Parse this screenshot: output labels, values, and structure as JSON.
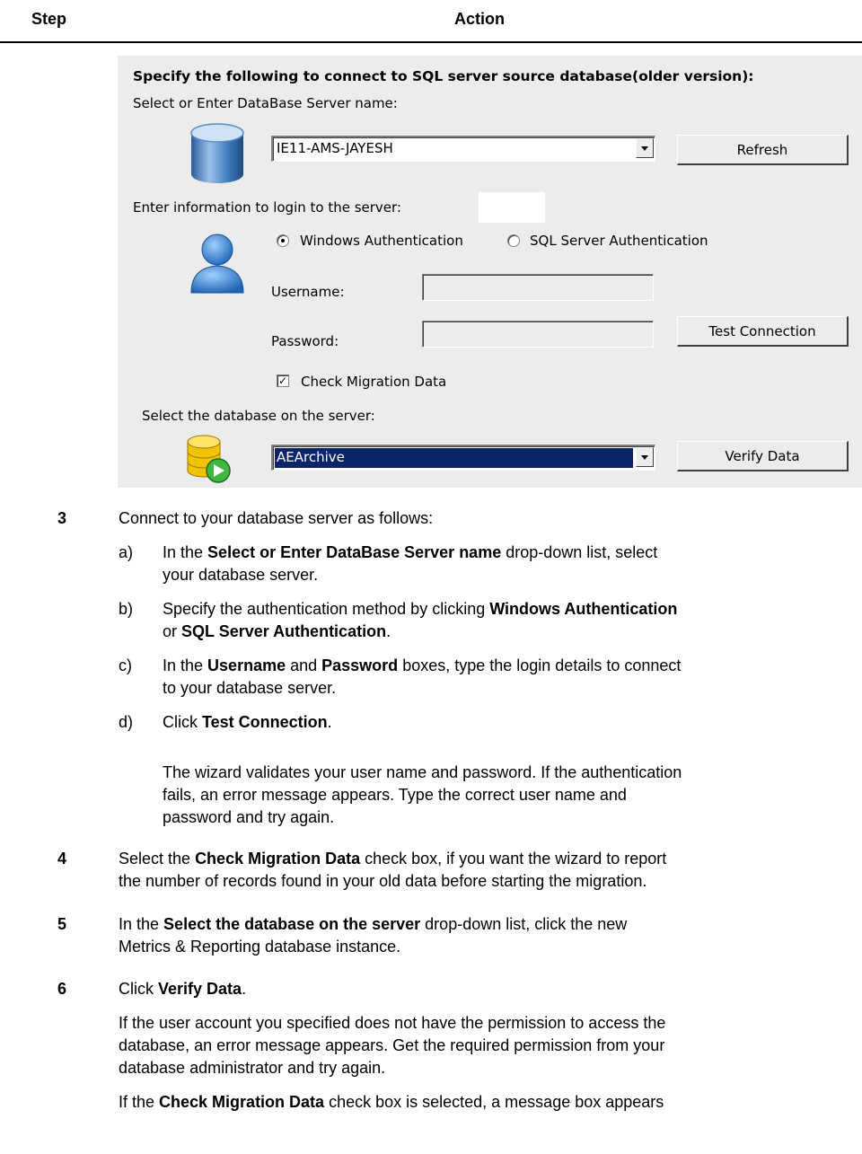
{
  "header": {
    "step": "Step",
    "action": "Action"
  },
  "dialog": {
    "title": "Specify the following to connect to SQL server source database(older version):",
    "server_label": "Select or Enter DataBase Server name:",
    "server_value": "IE11-AMS-JAYESH",
    "refresh": "Refresh",
    "login_label": "Enter information to login to the server:",
    "windows_auth": "Windows Authentication",
    "sql_auth": "SQL Server Authentication",
    "username_label": "Username:",
    "password_label": "Password:",
    "test_connection": "Test Connection",
    "check_migration": "Check Migration Data",
    "database_label": "Select the database on the server:",
    "database_value": "AEArchive",
    "verify_data": "Verify Data"
  },
  "steps": {
    "s3": {
      "num": "3",
      "intro": "Connect to your database server as follows:",
      "a_label": "a)",
      "a_pre": "In the ",
      "a_bold": "Select or Enter DataBase Server name",
      "a_post": " drop-down list, select",
      "a_line2": "your database server.",
      "b_label": "b)",
      "b_pre": "Specify the authentication method by clicking ",
      "b_bold1": "Windows Authentication",
      "b_or": "or ",
      "b_bold2": "SQL Server Authentication",
      "b_post": ".",
      "c_label": "c)",
      "c_pre": "In the ",
      "c_bold1": "Username",
      "c_and": " and ",
      "c_bold2": "Password",
      "c_post": " boxes, type the login details to connect",
      "c_line2": "to your database server.",
      "d_label": "d)",
      "d_pre": "Click ",
      "d_bold": "Test Connection",
      "d_post": ".",
      "note_l1": "The wizard validates your user name and password. If the authentication",
      "note_l2": "fails, an error message appears. Type the correct user name and",
      "note_l3": "password and try again."
    },
    "s4": {
      "num": "4",
      "pre": "Select the ",
      "bold": "Check Migration Data",
      "post": " check box, if you want the wizard to report",
      "line2": "the number of records found in your old data before starting the migration."
    },
    "s5": {
      "num": "5",
      "pre": "In the ",
      "bold": "Select the database on the server",
      "post": " drop-down list, click the new",
      "line2": "Metrics & Reporting database instance."
    },
    "s6": {
      "num": "6",
      "pre": "Click ",
      "bold": "Verify Data",
      "post": ".",
      "p1_l1": "If the user account you specified does not have the permission to access the",
      "p1_l2": "database, an error message appears. Get the required permission from your",
      "p1_l3": "database administrator and try again.",
      "p2_pre": "If the ",
      "p2_bold": "Check Migration Data",
      "p2_post": " check box is selected, a message box appears"
    }
  },
  "icons": {
    "server": "database-server-icon",
    "user": "user-icon",
    "database": "database-run-icon"
  }
}
